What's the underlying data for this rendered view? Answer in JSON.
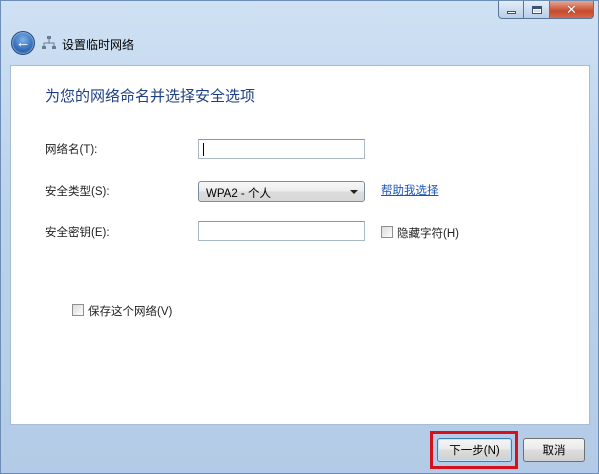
{
  "header": {
    "title": "设置临时网络"
  },
  "main": {
    "heading": "为您的网络命名并选择安全选项",
    "network_name": {
      "label": "网络名(T):",
      "value": ""
    },
    "security_type": {
      "label": "安全类型(S):",
      "selected": "WPA2 - 个人",
      "help_link": "帮助我选择"
    },
    "security_key": {
      "label": "安全密钥(E):",
      "value": "",
      "hide_chars_label": "隐藏字符(H)"
    },
    "save_network_label": "保存这个网络(V)"
  },
  "footer": {
    "next_label": "下一步(N)",
    "cancel_label": "取消"
  },
  "colors": {
    "heading": "#1e3f86",
    "link": "#1a56b8",
    "highlight": "#d4121b"
  },
  "icons": {
    "back": "back-arrow-icon",
    "network": "network-icon",
    "minimize": "minimize-icon",
    "maximize": "maximize-icon",
    "close": "close-icon"
  }
}
